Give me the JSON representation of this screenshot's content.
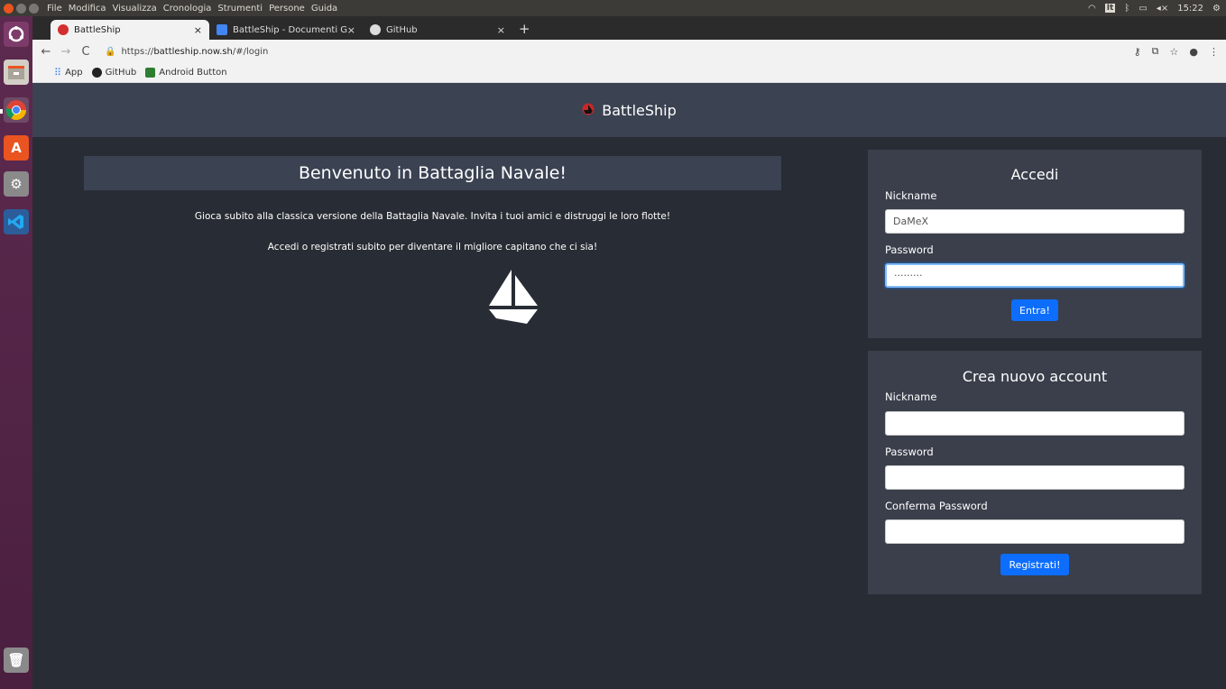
{
  "system": {
    "menu": [
      "File",
      "Modifica",
      "Visualizza",
      "Cronologia",
      "Strumenti",
      "Persone",
      "Guida"
    ],
    "keyboard": "It",
    "volume": "◂×",
    "time": "15:22"
  },
  "browser": {
    "tabs": [
      {
        "label": "BattleShip",
        "close": "×"
      },
      {
        "label": "BattleShip - Documenti G",
        "close": "×"
      },
      {
        "label": "GitHub",
        "close": "×"
      }
    ],
    "new_tab": "+",
    "url_prefix": "https://",
    "url_host": "battleship.now.sh",
    "url_path": "/#/login",
    "bookmarks": [
      "App",
      "GitHub",
      "Android Button"
    ]
  },
  "app": {
    "brand": "BattleShip",
    "welcome_title": "Benvenuto in Battaglia Navale!",
    "intro_line1": "Gioca subito alla classica versione della Battaglia Navale. Invita i tuoi amici e distruggi le loro flotte!",
    "intro_line2": "Accedi o registrati subito per diventare il migliore capitano che ci sia!"
  },
  "login": {
    "title": "Accedi",
    "nickname_label": "Nickname",
    "nickname_value": "DaMeX",
    "password_label": "Password",
    "password_value": "·········",
    "submit": "Entra!"
  },
  "register": {
    "title": "Crea nuovo account",
    "nickname_label": "Nickname",
    "password_label": "Password",
    "confirm_label": "Conferma Password",
    "submit": "Registrati!"
  }
}
